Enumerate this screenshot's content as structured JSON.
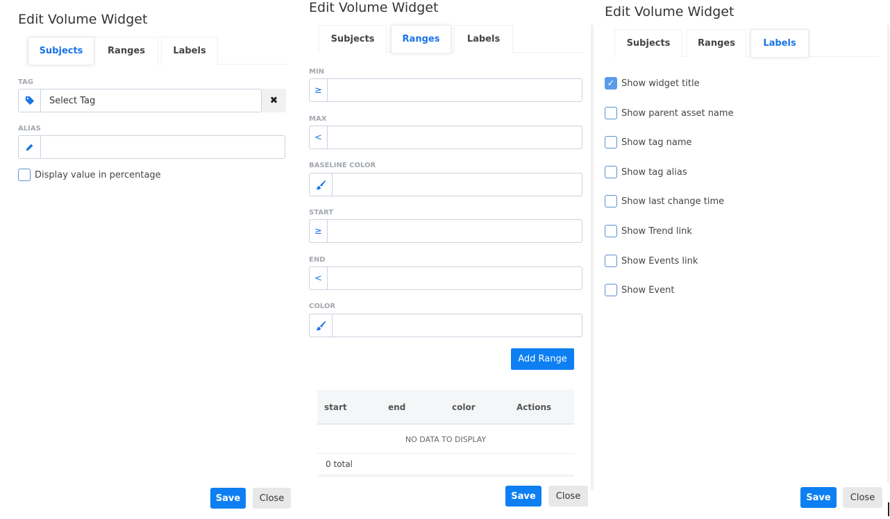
{
  "panels": [
    {
      "title": "Edit Volume Widget",
      "tabs": [
        "Subjects",
        "Ranges",
        "Labels"
      ],
      "active_tab": "Subjects",
      "tag_label": "TAG",
      "tag_placeholder": "Select Tag",
      "alias_label": "ALIAS",
      "alias_value": "",
      "percentage_checkbox": {
        "label": "Display value in percentage",
        "checked": false
      },
      "save_label": "Save",
      "close_label": "Close"
    },
    {
      "title": "Edit Volume Widget",
      "tabs": [
        "Subjects",
        "Ranges",
        "Labels"
      ],
      "active_tab": "Ranges",
      "fields": [
        {
          "label": "MIN",
          "prefix": "≥",
          "value": ""
        },
        {
          "label": "MAX",
          "prefix": "<",
          "value": ""
        },
        {
          "label": "BASELINE COLOR",
          "prefix": "brush-icon",
          "value": ""
        },
        {
          "label": "START",
          "prefix": "≥",
          "value": ""
        },
        {
          "label": "END",
          "prefix": "<",
          "value": ""
        },
        {
          "label": "COLOR",
          "prefix": "brush-icon",
          "value": ""
        }
      ],
      "add_range_label": "Add Range",
      "table": {
        "columns": [
          "start",
          "end",
          "color",
          "Actions"
        ],
        "empty_text": "NO DATA TO DISPLAY",
        "total_text": "0 total"
      },
      "save_label": "Save",
      "close_label": "Close"
    },
    {
      "title": "Edit Volume Widget",
      "tabs": [
        "Subjects",
        "Ranges",
        "Labels"
      ],
      "active_tab": "Labels",
      "checkboxes": [
        {
          "label": "Show widget title",
          "checked": true
        },
        {
          "label": "Show parent asset name",
          "checked": false
        },
        {
          "label": "Show tag name",
          "checked": false
        },
        {
          "label": "Show tag alias",
          "checked": false
        },
        {
          "label": "Show last change time",
          "checked": false
        },
        {
          "label": "Show Trend link",
          "checked": false
        },
        {
          "label": "Show Events link",
          "checked": false
        },
        {
          "label": "Show Event",
          "checked": false
        }
      ],
      "save_label": "Save",
      "close_label": "Close"
    }
  ],
  "colors": {
    "accent": "#1a73e8",
    "primary_button": "#0d7ff2",
    "secondary_button": "#e8e8e8"
  },
  "icons": {
    "tag": "tag-icon",
    "alias": "pencil-icon",
    "clear": "close-icon",
    "color": "brush-icon"
  }
}
